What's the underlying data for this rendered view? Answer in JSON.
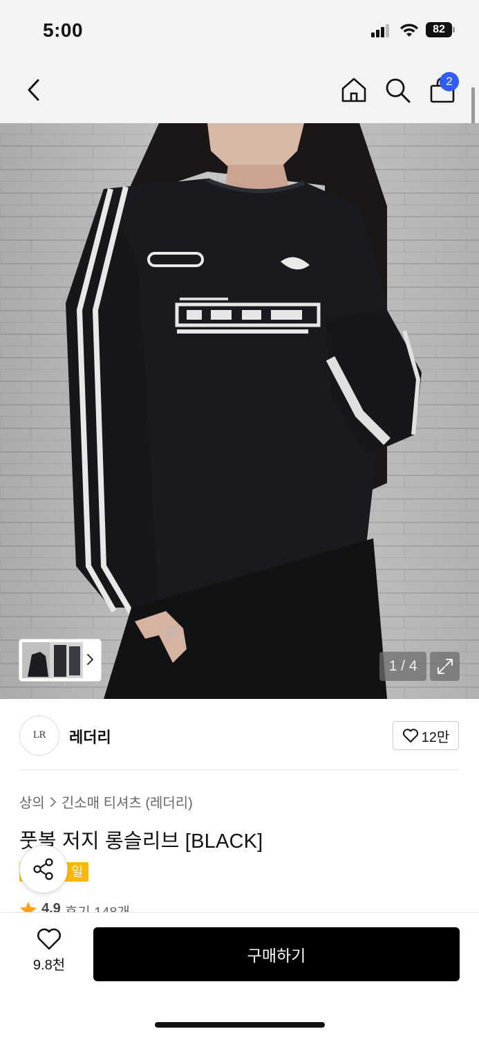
{
  "status_bar": {
    "time": "5:00",
    "battery": "82"
  },
  "nav": {
    "back_icon": "chevron-left-icon",
    "home_icon": "home-icon",
    "search_icon": "search-icon",
    "cart_icon": "shopping-bag-icon",
    "cart_count": "2"
  },
  "gallery": {
    "counter": "1 / 4",
    "expand_icon": "expand-icon",
    "thumbnail_arrow_icon": "chevron-right-icon"
  },
  "brand": {
    "logo_mark": "LR",
    "name": "레더리",
    "like_count": "12만"
  },
  "product": {
    "breadcrumb": [
      "상의",
      "긴소매 티셔츠 (레더리)"
    ],
    "title": "풋볼 저지 롱슬리브 [BLACK]",
    "tag": "일",
    "rating_score": "4.9",
    "review_text": "후기 148개"
  },
  "bottom_bar": {
    "wish_count": "9.8천",
    "buy_label": "구매하기"
  },
  "colors": {
    "accent_blue": "#2f5bff",
    "badge_yellow": "#ffb800",
    "star_orange": "#ff9f1a",
    "buy_black": "#000000"
  }
}
